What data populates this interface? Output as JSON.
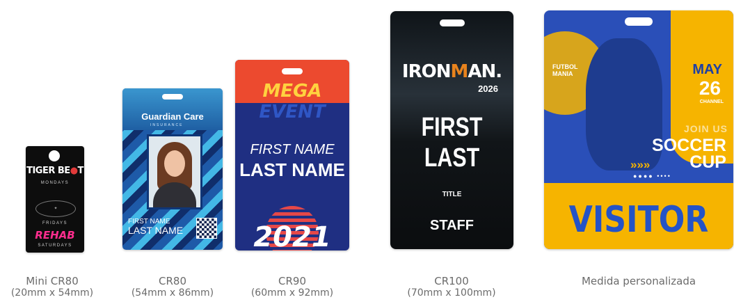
{
  "cards": [
    {
      "id": "mini",
      "name": "Mini CR80",
      "size": "(20mm x 54mm)",
      "design": {
        "brand_a": "TIGER BE",
        "brand_b": "●",
        "brand_c": "T",
        "day1": "MONDAYS",
        "day2": "FRIDAYS",
        "logo2": "✦",
        "rehab": "REHAB",
        "day3": "SATURDAYS"
      }
    },
    {
      "id": "cr80",
      "name": "CR80",
      "size": "(54mm x 86mm)",
      "design": {
        "brand": "Guardian Care",
        "brand_sub": "INSURANCE",
        "first_name": "FIRST NAME",
        "last_name": "LAST NAME"
      }
    },
    {
      "id": "cr90",
      "name": "CR90",
      "size": "(60mm x 92mm)",
      "design": {
        "line1": "MEGA",
        "line2": "EVENT",
        "first_name": "FIRST NAME",
        "last_name": "LAST NAME",
        "year": "2021"
      }
    },
    {
      "id": "cr100",
      "name": "CR100",
      "size": "(70mm x 100mm)",
      "design": {
        "brand_a": "IRON",
        "brand_b": "M",
        "brand_c": "AN.",
        "year": "2026",
        "first": "FIRST",
        "last": "LAST",
        "title": "TITLE",
        "role": "STAFF"
      }
    },
    {
      "id": "custom",
      "name": "Medida personalizada",
      "size": "",
      "design": {
        "futbol": "FUTBOL",
        "mania": "MANIA",
        "month": "MAY",
        "day": "26",
        "channel": "CHANNEL",
        "join": "JOIN US",
        "soccer": "SOCCER",
        "cup": "CUP",
        "chevrons": "»»»",
        "dots": "●●●● ••••",
        "visitor": "VISITOR"
      }
    }
  ]
}
